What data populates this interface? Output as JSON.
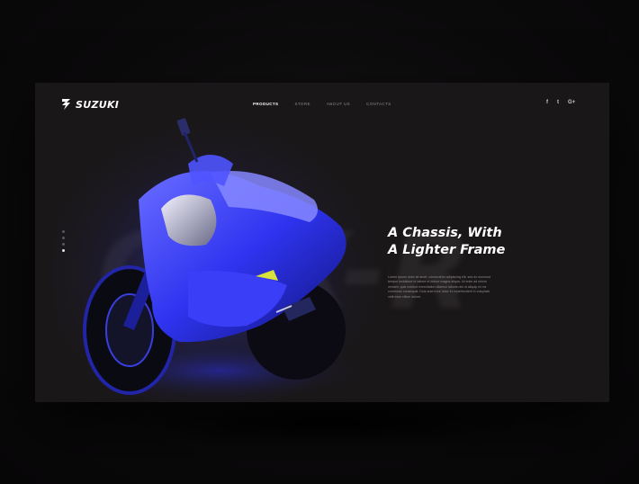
{
  "brand": {
    "name": "SUZUKI"
  },
  "nav": {
    "items": [
      {
        "label": "PRODUCTS",
        "active": true
      },
      {
        "label": "STORE",
        "active": false
      },
      {
        "label": "ABOUT US",
        "active": false
      },
      {
        "label": "CONTACTS",
        "active": false
      }
    ]
  },
  "social": {
    "icons": [
      {
        "glyph": "f",
        "name": "facebook-icon"
      },
      {
        "glyph": "t",
        "name": "twitter-icon"
      },
      {
        "glyph": "G+",
        "name": "google-plus-icon"
      }
    ]
  },
  "slider": {
    "dots": 4,
    "active_index": 3
  },
  "watermark": "GSX-R",
  "hero": {
    "title_line1": "A Chassis, With",
    "title_line2": "A Lighter Frame",
    "body_lines": [
      "Lorem ipsum dolor sit amet, consectetur adipiscing elit, sed do eiusmod",
      "tempor incididunt ut labore et dolore magna aliqua. Ut enim ad minim",
      "veniam, quis nostrud exercitation ullamco laboris nisi ut aliquip ex ea",
      "commodo consequat. Duis aute irure dolor in reprehenderit in voluptate",
      "velit esse cillum dolore."
    ]
  },
  "colors": {
    "accent": "#2f34f0",
    "background": "#1a1718",
    "text_primary": "#ffffff"
  }
}
